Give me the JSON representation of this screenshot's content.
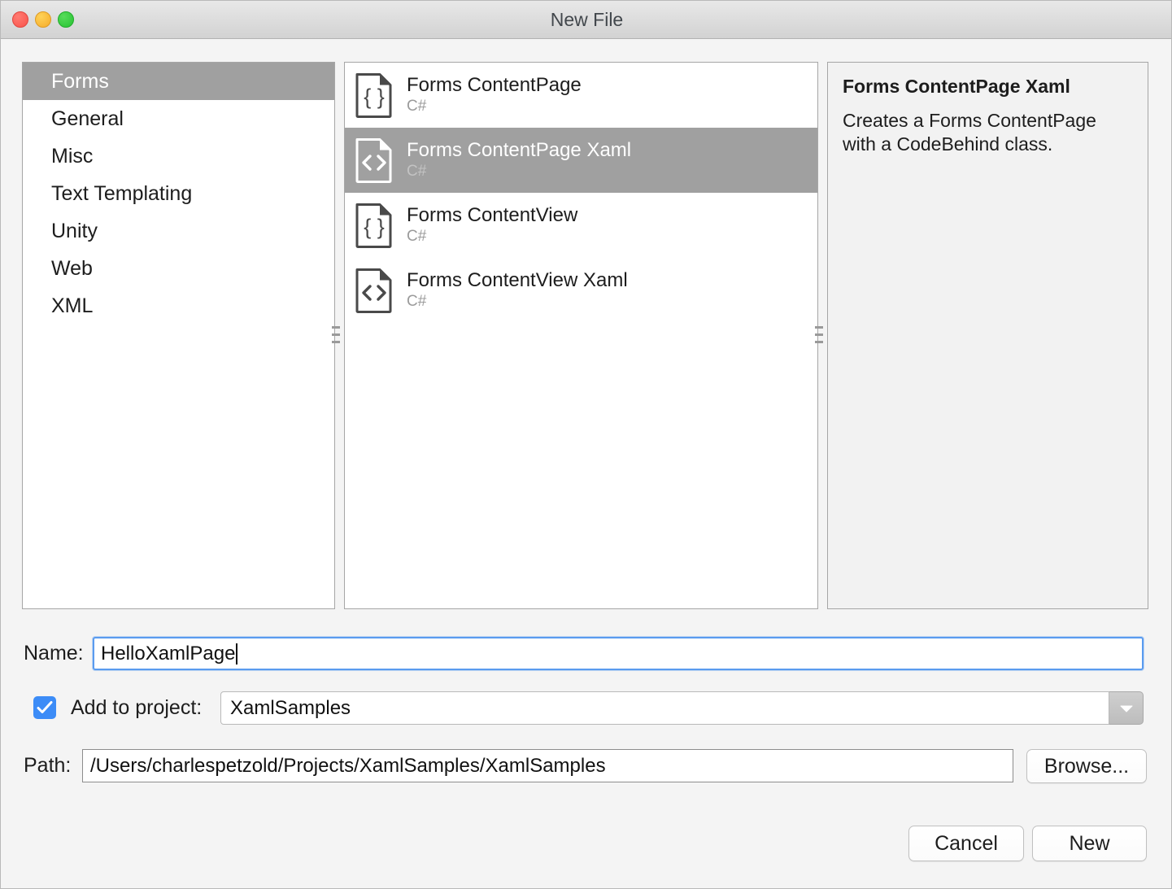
{
  "window": {
    "title": "New File",
    "traffic_lights": [
      "close",
      "minimize",
      "maximize"
    ]
  },
  "categories": {
    "items": [
      {
        "label": "Forms",
        "selected": true
      },
      {
        "label": "General",
        "selected": false
      },
      {
        "label": "Misc",
        "selected": false
      },
      {
        "label": "Text Templating",
        "selected": false
      },
      {
        "label": "Unity",
        "selected": false
      },
      {
        "label": "Web",
        "selected": false
      },
      {
        "label": "XML",
        "selected": false
      }
    ]
  },
  "templates": {
    "items": [
      {
        "title": "Forms ContentPage",
        "language": "C#",
        "icon": "braces-document-icon",
        "selected": false
      },
      {
        "title": "Forms ContentPage Xaml",
        "language": "C#",
        "icon": "angle-brackets-document-icon",
        "selected": true
      },
      {
        "title": "Forms ContentView",
        "language": "C#",
        "icon": "braces-document-icon",
        "selected": false
      },
      {
        "title": "Forms ContentView Xaml",
        "language": "C#",
        "icon": "angle-brackets-document-icon",
        "selected": false
      }
    ]
  },
  "description": {
    "title": "Forms ContentPage Xaml",
    "body": "Creates a Forms ContentPage with a CodeBehind class."
  },
  "form": {
    "name_label": "Name:",
    "name_value": "HelloXamlPage",
    "add_to_project_label": "Add to project:",
    "add_to_project_checked": true,
    "project_value": "XamlSamples",
    "path_label": "Path:",
    "path_value": "/Users/charlespetzold/Projects/XamlSamples/XamlSamples",
    "browse_label": "Browse..."
  },
  "actions": {
    "cancel_label": "Cancel",
    "new_label": "New"
  },
  "colors": {
    "selection": "#a0a0a0",
    "focus_ring": "#5a9bef",
    "checkbox": "#3c8cf7",
    "titlebar_text": "#42474c",
    "panel_background": "#f2f2f2"
  }
}
